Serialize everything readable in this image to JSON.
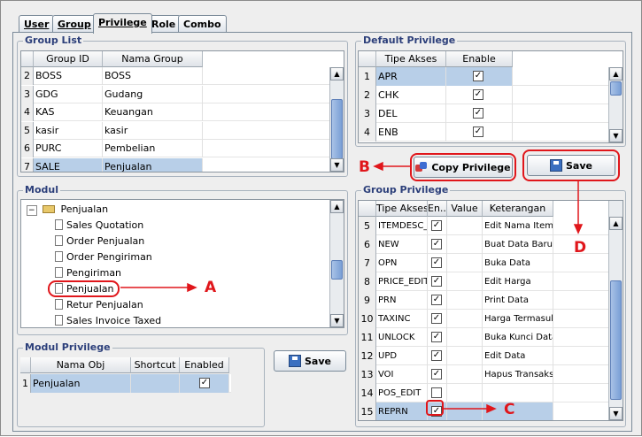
{
  "tabs": [
    "User",
    "Group",
    "Privilege",
    "Role",
    "Combo"
  ],
  "active_tab": "Privilege",
  "group_list": {
    "title": "Group List",
    "columns": [
      "Group ID",
      "Nama Group"
    ],
    "rows": [
      {
        "n": "2",
        "id": "BOSS",
        "name": "BOSS"
      },
      {
        "n": "3",
        "id": "GDG",
        "name": "Gudang"
      },
      {
        "n": "4",
        "id": "KAS",
        "name": "Keuangan"
      },
      {
        "n": "5",
        "id": "kasir",
        "name": "kasir"
      },
      {
        "n": "6",
        "id": "PURC",
        "name": "Pembelian"
      },
      {
        "n": "7",
        "id": "SALE",
        "name": "Penjualan"
      }
    ]
  },
  "modul": {
    "title": "Modul",
    "root": "Penjualan",
    "items": [
      "Sales Quotation",
      "Order Penjualan",
      "Order Pengiriman",
      "Pengiriman",
      "Penjualan",
      "Retur Penjualan",
      "Sales Invoice Taxed"
    ]
  },
  "modul_privilege": {
    "title": "Modul Privilege",
    "columns": [
      "Nama Obj",
      "Shortcut",
      "Enabled"
    ],
    "rows": [
      {
        "n": "1",
        "name": "Penjualan",
        "shortcut": "",
        "enabled": true
      }
    ],
    "save_label": "Save"
  },
  "default_privilege": {
    "title": "Default Privilege",
    "columns": [
      "Tipe Akses",
      "Enable"
    ],
    "rows": [
      {
        "n": "1",
        "akses": "APR",
        "enable": true
      },
      {
        "n": "2",
        "akses": "CHK",
        "enable": true
      },
      {
        "n": "3",
        "akses": "DEL",
        "enable": true
      },
      {
        "n": "4",
        "akses": "ENB",
        "enable": true
      }
    ]
  },
  "buttons": {
    "copy_privilege": "Copy Privilege",
    "save": "Save"
  },
  "group_privilege": {
    "title": "Group Privilege",
    "columns": [
      "Tipe Akses",
      "En...",
      "Value",
      "Keterangan"
    ],
    "rows": [
      {
        "n": "5",
        "akses": "ITEMDESC_...",
        "en": true,
        "value": "",
        "ket": "Edit Nama Item"
      },
      {
        "n": "6",
        "akses": "NEW",
        "en": true,
        "value": "",
        "ket": "Buat Data Baru"
      },
      {
        "n": "7",
        "akses": "OPN",
        "en": true,
        "value": "",
        "ket": "Buka Data"
      },
      {
        "n": "8",
        "akses": "PRICE_EDIT",
        "en": true,
        "value": "",
        "ket": "Edit Harga"
      },
      {
        "n": "9",
        "akses": "PRN",
        "en": true,
        "value": "",
        "ket": "Print Data"
      },
      {
        "n": "10",
        "akses": "TAXINC",
        "en": true,
        "value": "",
        "ket": "Harga Termasuk"
      },
      {
        "n": "11",
        "akses": "UNLOCK",
        "en": true,
        "value": "",
        "ket": "Buka Kunci Data"
      },
      {
        "n": "12",
        "akses": "UPD",
        "en": true,
        "value": "",
        "ket": "Edit Data"
      },
      {
        "n": "13",
        "akses": "VOI",
        "en": true,
        "value": "",
        "ket": "Hapus Transaks"
      },
      {
        "n": "14",
        "akses": "POS_EDIT",
        "en": false,
        "value": "",
        "ket": ""
      },
      {
        "n": "15",
        "akses": "REPRN",
        "en": true,
        "value": "",
        "ket": ""
      }
    ]
  },
  "annotations": {
    "a": "A",
    "b": "B",
    "c": "C",
    "d": "D"
  },
  "colors": {
    "annotation": "#e0161b",
    "selection": "#b8cfe8",
    "title": "#2c3f7a"
  }
}
